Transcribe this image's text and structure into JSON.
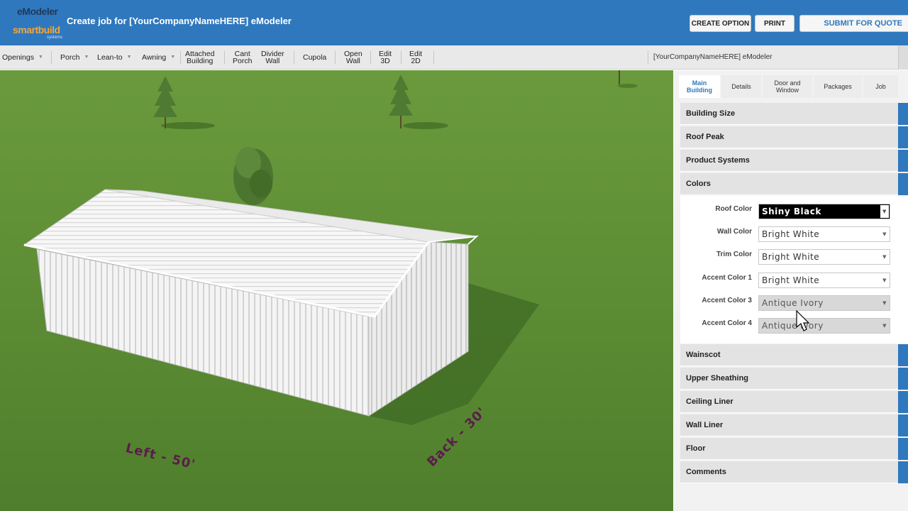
{
  "header": {
    "title": "Create job for [YourCompanyNameHERE] eModeler",
    "logo_line1": "eModeler",
    "logo_line2": "smartbuild",
    "logo_line3": "systems",
    "create_option": "CREATE OPTION",
    "print": "PRINT",
    "submit": "SUBMIT FOR QUOTE"
  },
  "toolbar": {
    "openings": "Openings",
    "porch": "Porch",
    "lean_to": "Lean-to",
    "awning": "Awning",
    "attached_building_1": "Attached",
    "attached_building_2": "Building",
    "cant_porch_1": "Cant",
    "cant_porch_2": "Porch",
    "divider_wall_1": "Divider",
    "divider_wall_2": "Wall",
    "cupola": "Cupola",
    "open_wall_1": "Open",
    "open_wall_2": "Wall",
    "edit_3d_1": "Edit",
    "edit_3d_2": "3D",
    "edit_2d_1": "Edit",
    "edit_2d_2": "2D",
    "right_label": "[YourCompanyNameHERE] eModeler"
  },
  "viewport": {
    "label_left": "Left - 50'",
    "label_back": "Back - 30'"
  },
  "tabs": {
    "main_building_1": "Main",
    "main_building_2": "Building",
    "details": "Details",
    "door_window_1": "Door and",
    "door_window_2": "Window",
    "packages": "Packages",
    "job": "Job"
  },
  "sections": {
    "building_size": "Building Size",
    "roof_peak": "Roof Peak",
    "product_systems": "Product Systems",
    "colors": "Colors",
    "wainscot": "Wainscot",
    "upper_sheathing": "Upper Sheathing",
    "ceiling_liner": "Ceiling Liner",
    "wall_liner": "Wall Liner",
    "floor": "Floor",
    "comments": "Comments"
  },
  "colors": {
    "roof_label": "Roof Color",
    "roof_value": "Shiny Black",
    "wall_label": "Wall Color",
    "wall_value": "Bright White",
    "trim_label": "Trim Color",
    "trim_value": "Bright White",
    "accent1_label": "Accent Color 1",
    "accent1_value": "Bright White",
    "accent3_label": "Accent Color 3",
    "accent3_value": "Antique Ivory",
    "accent4_label": "Accent Color 4",
    "accent4_value": "Antique Ivory"
  },
  "theme": {
    "accent": "#2f78bd",
    "grass": "#5a8a32",
    "dimension_label": "#5b1d4b"
  }
}
